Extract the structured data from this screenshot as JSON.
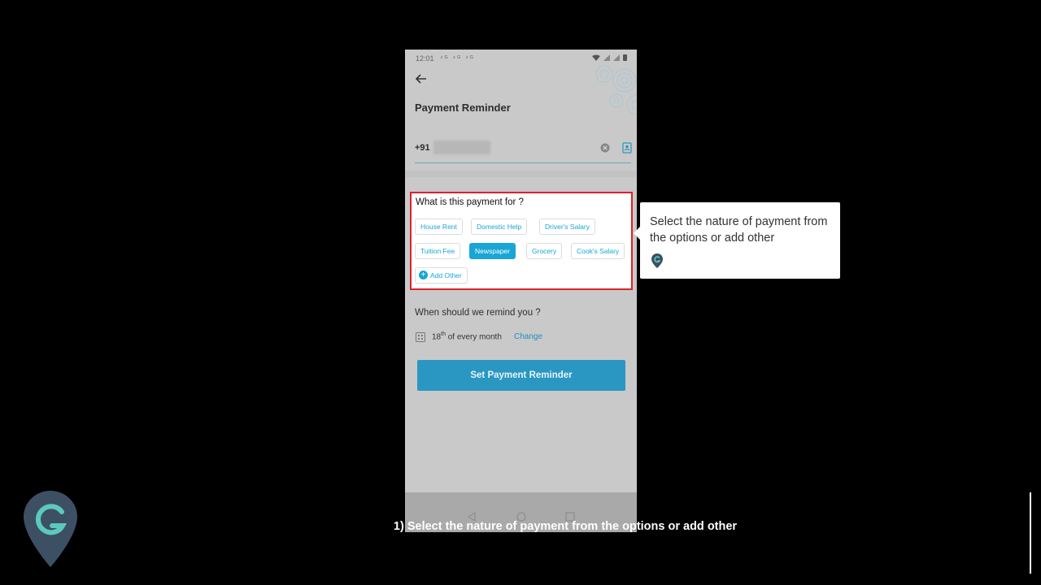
{
  "status_bar": {
    "time": "12:01",
    "sim_indicators": "⁴ᴳ ⁴ᴳ ⁴ᴳ"
  },
  "screen": {
    "title": "Payment Reminder",
    "country_code": "+91"
  },
  "payment_for": {
    "question": "What is this payment for ?",
    "chips": [
      {
        "label": "House Rent",
        "selected": false
      },
      {
        "label": "Domestic Help",
        "selected": false
      },
      {
        "label": "Driver's Salary",
        "selected": false
      },
      {
        "label": "Tuition Fee",
        "selected": false
      },
      {
        "label": "Newspaper",
        "selected": true
      },
      {
        "label": "Grocery",
        "selected": false
      },
      {
        "label": "Cook's Salary",
        "selected": false
      }
    ],
    "add_other_label": "Add Other"
  },
  "remind": {
    "question": "When should we remind you ?",
    "day": "18",
    "day_suffix": "th",
    "day_rest": " of every month",
    "change_label": "Change"
  },
  "set_button_label": "Set Payment Reminder",
  "tooltip_text": "Select the nature of payment from the options or add other",
  "caption": "1) Select the nature of payment from the options or add other",
  "colors": {
    "accent": "#19a6d6",
    "highlight_border": "#e0202a",
    "button": "#2a97c2",
    "brand_logo": "#3d4f63",
    "brand_logo_letter": "#5cc9c0"
  },
  "icons": [
    "back-arrow-icon",
    "clear-icon",
    "contact-book-icon",
    "calendar-icon",
    "plus-circle-icon",
    "brand-logo-icon"
  ]
}
